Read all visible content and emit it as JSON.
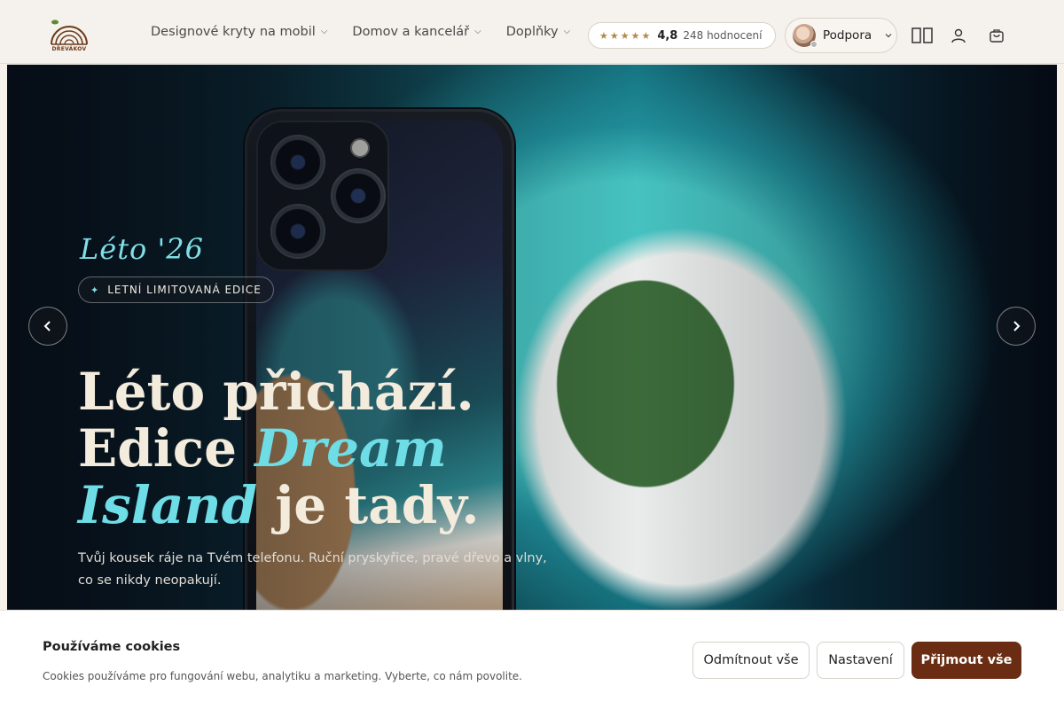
{
  "header": {
    "logo_text": "DŘEVÁKOV",
    "nav": [
      {
        "label": "Designové kryty na mobil"
      },
      {
        "label": "Domov a kancelář"
      },
      {
        "label": "Doplňky"
      }
    ],
    "rating": {
      "stars": "★★★★★",
      "value": "4,8",
      "count": "248 hodnocení"
    },
    "support_label": "Podpora"
  },
  "hero": {
    "script": "Léto '26",
    "badge": "LETNÍ LIMITOVANÁ EDICE",
    "headline": {
      "line1": "Léto přichází.",
      "line2a": "Edice ",
      "line2b": "Dream",
      "line3a": "Island",
      "line3b": " je tady."
    },
    "subtitle": "Tvůj kousek ráje na Tvém telefonu. Ruční pryskyřice, pravé dřevo a vlny, co se nikdy neopakují."
  },
  "cookie": {
    "title": "Používáme cookies",
    "text": "Cookies používáme pro fungování webu, analytiku a marketing. Vyberte, co nám povolite.",
    "reject": "Odmítnout vše",
    "settings": "Nastavení",
    "accept": "Přijmout vše"
  },
  "colors": {
    "accent": "#6a2d13",
    "highlight": "#6fdde6",
    "stars": "#b38a4a"
  }
}
